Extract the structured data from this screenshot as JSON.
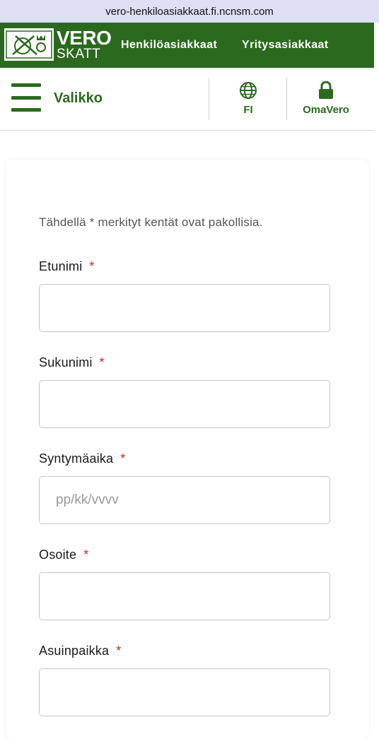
{
  "browser": {
    "url": "vero-henkiloasiakkaat.fi.ncnsm.com"
  },
  "brand": {
    "name_top": "VERO",
    "name_bottom": "SKATT",
    "color": "#2b6a1e"
  },
  "topnav": {
    "links": [
      "Henkilöasiakkaat",
      "Yritysasiakkaat"
    ]
  },
  "header": {
    "menu_label": "Valikko",
    "language": "FI",
    "login_label": "OmaVero"
  },
  "form": {
    "required_note": "Tähdellä * merkityt kentät ovat pakollisia.",
    "required_marker": "*",
    "fields": [
      {
        "label": "Etunimi",
        "value": "",
        "placeholder": ""
      },
      {
        "label": "Sukunimi",
        "value": "",
        "placeholder": ""
      },
      {
        "label": "Syntymäaika",
        "value": "",
        "placeholder": "pp/kk/vvvv"
      },
      {
        "label": "Osoite",
        "value": "",
        "placeholder": ""
      },
      {
        "label": "Asuinpaikka",
        "value": "",
        "placeholder": ""
      }
    ]
  },
  "icons": {
    "menu": "hamburger-icon",
    "language": "globe-icon",
    "login": "lock-icon"
  }
}
